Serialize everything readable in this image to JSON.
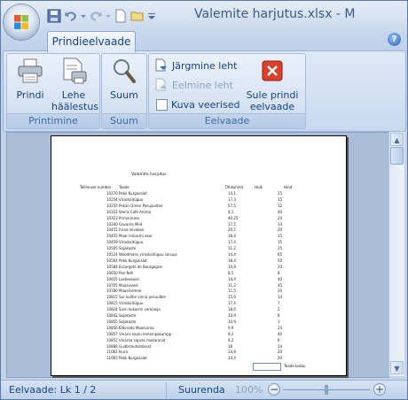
{
  "window": {
    "title": "Valemite harjutus.xlsx - M"
  },
  "ribbon": {
    "active_tab": "Prindieelvaade",
    "groups": {
      "print": {
        "label": "Printimine",
        "print_button": "Prindi",
        "page_setup_button": [
          "Lehe",
          "häälestus"
        ]
      },
      "zoom": {
        "label": "Suum",
        "zoom_button": "Suum"
      },
      "preview": {
        "label": "Eelvaade",
        "next_page": "Järgmine leht",
        "prev_page": "Eelmine leht",
        "show_margins": "Kuva veerised",
        "close_preview": [
          "Sule prindi",
          "eelvaade"
        ]
      }
    }
  },
  "page": {
    "title": "Valemite harjutus",
    "headers": {
      "order": "Tellimuse number",
      "product": "Toode",
      "unit_price": "Ühikuhind",
      "discount": "Hulk",
      "qty": "Hind"
    },
    "rows": [
      {
        "id": "10270",
        "name": "Pekk Kurgasalat",
        "price": "14,1",
        "qty": "25"
      },
      {
        "id": "10254",
        "name": "Viraskaitüguu",
        "price": "17,3",
        "qty": "15"
      },
      {
        "id": "10255",
        "name": "Pekan Green Pasujaulber",
        "price": "57,5",
        "qty": "12"
      },
      {
        "id": "10322",
        "name": "Vaera Café Aroma",
        "price": "4,1",
        "qty": "40"
      },
      {
        "id": "10323",
        "name": "Primarzuna",
        "price": "40,25",
        "qty": "24"
      },
      {
        "id": "10340",
        "name": "Gavarila Miid",
        "price": "17,5",
        "qty": "14"
      },
      {
        "id": "10455",
        "name": "Fiana leivakoo",
        "price": "20,5",
        "qty": "20"
      },
      {
        "id": "10455",
        "name": "Maar leikasmi ekar",
        "price": "18,4",
        "qty": "15"
      },
      {
        "id": "10459",
        "name": "Viraskaitüguu",
        "price": "17,4",
        "qty": "15"
      },
      {
        "id": "10505",
        "name": "Sojakaste",
        "price": "11,2",
        "qty": "25"
      },
      {
        "id": "10524",
        "name": "Woodmans viraskaitüguu sarupa",
        "price": "14,4",
        "qty": "65"
      },
      {
        "id": "10564",
        "name": "Pekk Kurgasalat",
        "price": "18,4",
        "qty": "50"
      },
      {
        "id": "10584",
        "name": "Escargots de Bourgogne",
        "price": "10,8",
        "qty": "20"
      },
      {
        "id": "10650",
        "name": "Pan Nell",
        "price": "8,5",
        "qty": "8"
      },
      {
        "id": "10655",
        "name": "Laskeskoon",
        "price": "14,4",
        "qty": "40"
      },
      {
        "id": "10705",
        "name": "Maasineed",
        "price": "11,2",
        "qty": "45"
      },
      {
        "id": "10780",
        "name": "Maasinemee",
        "price": "11,5",
        "qty": "20"
      },
      {
        "id": "10815",
        "name": "Sur kulihe vinna pesuulber",
        "price": "15,6",
        "qty": "14"
      },
      {
        "id": "10815",
        "name": "Viraskaitüguu",
        "price": "17,4",
        "qty": "7"
      },
      {
        "id": "10824",
        "name": "Sixin leikasmi semiaeja",
        "price": "18,6",
        "qty": "2"
      },
      {
        "id": "10842",
        "name": "Sojakaste",
        "price": "10,9",
        "qty": "8"
      },
      {
        "id": "10855",
        "name": "Sojakaste",
        "price": "10,9",
        "qty": "3"
      },
      {
        "id": "10856",
        "name": "Eldorado Maasiaraa",
        "price": "9,9",
        "qty": "24"
      },
      {
        "id": "10857",
        "name": "Vinaris kaulu lemonipokumpp",
        "price": "9,2",
        "qty": "40"
      },
      {
        "id": "10857",
        "name": "Vinaraa sapras makaronid",
        "price": "9,2",
        "qty": "6"
      },
      {
        "id": "10889",
        "name": "Gudbrandsdalsost",
        "price": "18",
        "qty": "24"
      },
      {
        "id": "11062",
        "name": "Ikura",
        "price": "24,8",
        "qty": "20"
      },
      {
        "id": "11065",
        "name": "Pekk Kurgasalat",
        "price": "14,4",
        "qty": "20"
      }
    ],
    "total_label": "Toode kokku"
  },
  "statusbar": {
    "page_info": "Eelvaade: Lk 1 / 2",
    "zoom_label": "Suurenda",
    "zoom_value": "100%"
  }
}
